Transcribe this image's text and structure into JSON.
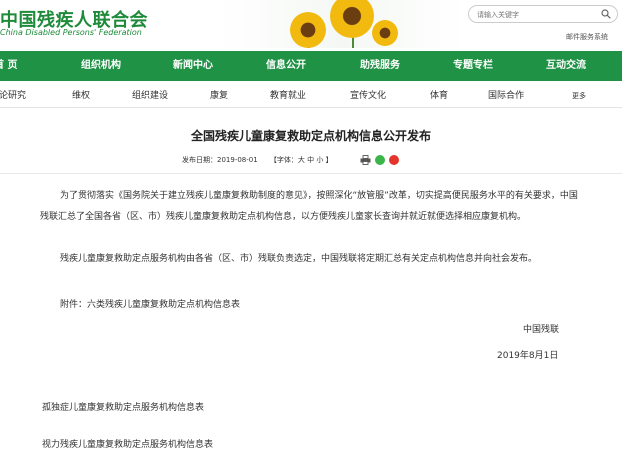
{
  "header": {
    "logo_cn": "中国残疾人联合会",
    "logo_en": "China Disabled Persons' Federation",
    "search_placeholder": "请输入关键字",
    "mail_link": "邮件服务系统"
  },
  "nav": {
    "items": [
      "首 页",
      "组织机构",
      "新闻中心",
      "信息公开",
      "助残服务",
      "专题专栏",
      "互动交流"
    ]
  },
  "subnav": {
    "items": [
      "理论研究",
      "维权",
      "组织建设",
      "康复",
      "教育就业",
      "宣传文化",
      "体育",
      "国际合作",
      "更多"
    ]
  },
  "article": {
    "title": "全国残疾儿童康复救助定点机构信息公开发布",
    "publish_date": "发布日期：2019-08-01",
    "font_size": "【字体：大 中 小 】",
    "para1": "为了贯彻落实《国务院关于建立残疾儿童康复救助制度的意见》，按照深化“放管服”改革，切实提高便民服务水平的有关要求，中国残联汇总了全国各省（区、市）残疾儿童康复救助定点机构信息，以方便残疾儿童家长查询并就近就便选择相应康复机构。",
    "para2": "残疾儿童康复救助定点服务机构由各省（区、市）残联负责选定，中国残联将定期汇总有关定点机构信息并向社会发布。",
    "attachment": "附件：六类残疾儿童康复救助定点机构信息表",
    "signature": "中国残联",
    "sign_date": "2019年8月1日",
    "files": [
      "孤独症儿童康复救助定点服务机构信息表",
      "视力残疾儿童康复救助定点服务机构信息表"
    ]
  },
  "colors": {
    "brand_green": "#1f9245",
    "share_wechat": "#3bb54a",
    "share_weibo": "#e2352b"
  }
}
